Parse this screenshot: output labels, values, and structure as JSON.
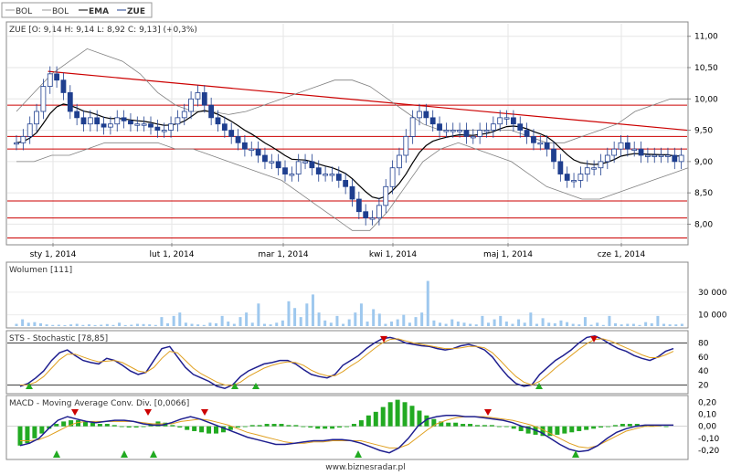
{
  "legend": {
    "items": [
      {
        "label": "BOL",
        "color": "#999999",
        "bold": false
      },
      {
        "label": "BOL",
        "color": "#999999",
        "bold": false
      },
      {
        "label": "EMA",
        "color": "#000000",
        "bold": true
      },
      {
        "label": "ZUE",
        "color": "#1f3f8f",
        "bold": true
      }
    ]
  },
  "footer": "www.biznesradar.pl",
  "colors": {
    "candle": "#1f3f8f",
    "trend": "#cc0000",
    "band": "#808080",
    "ema": "#000000",
    "volume": "#9ec8ee",
    "macd_pos": "#22aa22",
    "macd_neg": "#22aa22",
    "signal": "#e0a020"
  },
  "chart_data": [
    {
      "type": "candlestick",
      "title": "ZUE [O: 9,14  H: 9,14  L: 8,92  C: 9,13] (+0,3%)",
      "x_tick_labels": [
        "sty 1, 2014",
        "lut 1, 2014",
        "mar 1, 2014",
        "kwi 1, 2014",
        "maj 1, 2014",
        "cze 1, 2014"
      ],
      "y_tick_labels": [
        "8,00",
        "8,50",
        "9,00",
        "9,50",
        "10,00",
        "10,50",
        "11,00"
      ],
      "y_ticks": [
        8.0,
        8.5,
        9.0,
        9.5,
        10.0,
        10.5,
        11.0
      ],
      "ylim": [
        7.7,
        11.2
      ],
      "horizontal_levels": [
        9.9,
        9.4,
        9.2,
        8.37,
        8.1,
        7.78
      ],
      "trendline": {
        "from": [
          0.06,
          10.44
        ],
        "to": [
          1.0,
          9.5
        ]
      },
      "series_close": [
        9.3,
        9.4,
        9.6,
        9.8,
        10.2,
        10.4,
        10.3,
        10.1,
        9.8,
        9.7,
        9.6,
        9.7,
        9.6,
        9.55,
        9.6,
        9.7,
        9.65,
        9.6,
        9.6,
        9.6,
        9.55,
        9.5,
        9.5,
        9.6,
        9.7,
        9.8,
        10.0,
        10.1,
        9.9,
        9.7,
        9.6,
        9.5,
        9.4,
        9.3,
        9.2,
        9.2,
        9.1,
        9.0,
        9.0,
        8.9,
        8.8,
        8.8,
        9.0,
        9.0,
        8.9,
        8.8,
        8.8,
        8.8,
        8.7,
        8.6,
        8.4,
        8.2,
        8.1,
        8.1,
        8.3,
        8.6,
        8.9,
        9.1,
        9.4,
        9.7,
        9.8,
        9.7,
        9.6,
        9.5,
        9.5,
        9.5,
        9.5,
        9.4,
        9.4,
        9.5,
        9.5,
        9.6,
        9.7,
        9.7,
        9.6,
        9.5,
        9.4,
        9.3,
        9.3,
        9.2,
        9.0,
        8.8,
        8.7,
        8.7,
        8.8,
        8.9,
        8.9,
        9.0,
        9.1,
        9.2,
        9.3,
        9.2,
        9.2,
        9.1,
        9.1,
        9.1,
        9.1,
        9.1,
        9.0,
        9.1
      ],
      "bollinger_upper": [
        9.8,
        10.1,
        10.4,
        10.6,
        10.8,
        10.7,
        10.6,
        10.4,
        10.1,
        9.9,
        9.8,
        9.8,
        9.75,
        9.8,
        9.9,
        10.0,
        10.1,
        10.2,
        10.3,
        10.3,
        10.2,
        10.0,
        9.8,
        9.6,
        9.5,
        9.5,
        9.5,
        9.5,
        9.5,
        9.4,
        9.3,
        9.3,
        9.4,
        9.5,
        9.6,
        9.8,
        9.9,
        10.0,
        10.0
      ],
      "bollinger_lower": [
        9.0,
        9.0,
        9.1,
        9.1,
        9.2,
        9.3,
        9.3,
        9.3,
        9.3,
        9.2,
        9.2,
        9.1,
        9.0,
        8.9,
        8.8,
        8.7,
        8.5,
        8.3,
        8.1,
        7.9,
        7.9,
        8.2,
        8.6,
        9.0,
        9.2,
        9.3,
        9.2,
        9.1,
        9.0,
        8.8,
        8.6,
        8.5,
        8.4,
        8.4,
        8.5,
        8.6,
        8.7,
        8.8,
        8.9
      ]
    },
    {
      "type": "bar",
      "title": "Wolumen [111]",
      "y_tick_labels": [
        "10 000",
        "30 000"
      ],
      "y_ticks": [
        10000,
        30000
      ],
      "ylim": [
        0,
        55000
      ],
      "values": [
        2000,
        6000,
        3000,
        3500,
        2500,
        1500,
        1000,
        1200,
        800,
        1500,
        2000,
        1000,
        1500,
        900,
        1200,
        1800,
        1000,
        3000,
        900,
        1200,
        2000,
        1800,
        1500,
        1000,
        8000,
        2500,
        9000,
        12000,
        3000,
        2000,
        1500,
        1000,
        3000,
        2500,
        9000,
        4000,
        2000,
        8000,
        12000,
        3000,
        20000,
        2000,
        1500,
        3000,
        5000,
        22000,
        16000,
        8000,
        20000,
        28000,
        12000,
        5000,
        3000,
        9000,
        2000,
        6000,
        12000,
        20000,
        4000,
        15000,
        11000,
        2000,
        4000,
        6000,
        10000,
        3000,
        8000,
        12000,
        40000,
        5000,
        3000,
        2000,
        6000,
        4000,
        3000,
        2000,
        1500,
        9000,
        3000,
        6000,
        9000,
        4000,
        2000,
        6000,
        3000,
        12000,
        2000,
        7000,
        3000,
        2500,
        5000,
        3500,
        2000,
        1500,
        8000,
        1200,
        3000,
        1000,
        9000,
        2500,
        1500,
        2000,
        2000,
        1000,
        3500,
        2500,
        9000,
        2000,
        1500,
        1500,
        2000
      ]
    },
    {
      "type": "line",
      "title": "STS - Stochastic [78,85]",
      "y_tick_labels": [
        "20",
        "40",
        "60",
        "80"
      ],
      "y_ticks": [
        20,
        40,
        60,
        80
      ],
      "ylim": [
        10,
        95
      ],
      "levels": [
        20,
        80
      ],
      "series": [
        {
          "values": [
            18,
            22,
            30,
            40,
            55,
            66,
            70,
            62,
            55,
            52,
            50,
            58,
            55,
            48,
            40,
            35,
            38,
            55,
            72,
            75,
            60,
            45,
            35,
            30,
            25,
            18,
            15,
            20,
            32,
            40,
            45,
            50,
            52,
            55,
            55,
            50,
            42,
            35,
            32,
            30,
            35,
            48,
            55,
            62,
            72,
            80,
            86,
            88,
            85,
            80,
            78,
            76,
            75,
            72,
            70,
            72,
            76,
            78,
            75,
            70,
            60,
            45,
            32,
            22,
            18,
            20,
            35,
            45,
            55,
            62,
            70,
            80,
            88,
            90,
            85,
            78,
            72,
            68,
            62,
            58,
            55,
            60,
            68,
            72
          ]
        },
        {
          "values": [
            20,
            20,
            24,
            32,
            44,
            56,
            64,
            64,
            60,
            56,
            53,
            54,
            55,
            52,
            46,
            40,
            38,
            45,
            58,
            68,
            66,
            55,
            44,
            36,
            30,
            24,
            20,
            19,
            24,
            32,
            38,
            44,
            48,
            51,
            53,
            52,
            48,
            41,
            36,
            33,
            33,
            39,
            47,
            54,
            63,
            72,
            80,
            85,
            86,
            83,
            80,
            78,
            76,
            74,
            72,
            72,
            73,
            75,
            75,
            73,
            66,
            55,
            43,
            32,
            24,
            20,
            25,
            34,
            44,
            53,
            62,
            71,
            79,
            85,
            86,
            83,
            78,
            73,
            68,
            63,
            59,
            59,
            63,
            68
          ]
        }
      ]
    },
    {
      "type": "bar",
      "title": "MACD - Moving Average Conv. Div. [0,0066]",
      "y_tick_labels": [
        "-0,20",
        "-0,10",
        "0,00",
        "0,10",
        "0,20"
      ],
      "y_ticks": [
        -0.2,
        -0.1,
        0.0,
        0.1,
        0.2
      ],
      "ylim": [
        -0.26,
        0.24
      ],
      "histogram": [
        -0.16,
        -0.14,
        -0.1,
        -0.06,
        -0.02,
        0.02,
        0.04,
        0.05,
        0.05,
        0.04,
        0.03,
        0.02,
        0.02,
        0.01,
        0.0,
        -0.01,
        -0.01,
        0.0,
        0.02,
        0.04,
        0.03,
        0.01,
        -0.01,
        -0.03,
        -0.04,
        -0.05,
        -0.06,
        -0.06,
        -0.05,
        -0.03,
        -0.01,
        0.0,
        0.01,
        0.01,
        0.02,
        0.02,
        0.02,
        0.01,
        0.01,
        0.0,
        -0.01,
        -0.02,
        -0.02,
        -0.02,
        -0.01,
        0.0,
        0.02,
        0.05,
        0.09,
        0.12,
        0.16,
        0.2,
        0.22,
        0.2,
        0.17,
        0.13,
        0.09,
        0.06,
        0.04,
        0.03,
        0.03,
        0.02,
        0.02,
        0.01,
        0.01,
        0.01,
        0.0,
        0.0,
        -0.02,
        -0.04,
        -0.06,
        -0.07,
        -0.08,
        -0.08,
        -0.07,
        -0.06,
        -0.05,
        -0.04,
        -0.03,
        -0.02,
        -0.01,
        0.0,
        0.01,
        0.02,
        0.02,
        0.02,
        0.01,
        0.01,
        0.01,
        0.0
      ],
      "macd_line": [
        -0.16,
        -0.14,
        -0.1,
        -0.02,
        0.05,
        0.08,
        0.06,
        0.04,
        0.03,
        0.04,
        0.05,
        0.05,
        0.04,
        0.02,
        0.01,
        0.01,
        0.03,
        0.06,
        0.08,
        0.06,
        0.03,
        0.0,
        -0.03,
        -0.06,
        -0.09,
        -0.11,
        -0.13,
        -0.15,
        -0.15,
        -0.14,
        -0.13,
        -0.12,
        -0.12,
        -0.11,
        -0.11,
        -0.12,
        -0.14,
        -0.17,
        -0.2,
        -0.22,
        -0.18,
        -0.1,
        0.0,
        0.06,
        0.08,
        0.09,
        0.09,
        0.08,
        0.08,
        0.07,
        0.06,
        0.05,
        0.03,
        0.0,
        -0.02,
        -0.05,
        -0.1,
        -0.15,
        -0.19,
        -0.21,
        -0.2,
        -0.16,
        -0.1,
        -0.05,
        -0.02,
        0.0,
        0.01,
        0.01,
        0.01,
        0.01
      ],
      "signal_line": [
        -0.12,
        -0.12,
        -0.11,
        -0.08,
        -0.04,
        0.0,
        0.03,
        0.04,
        0.04,
        0.04,
        0.04,
        0.04,
        0.04,
        0.03,
        0.02,
        0.02,
        0.02,
        0.04,
        0.05,
        0.06,
        0.05,
        0.03,
        0.01,
        -0.02,
        -0.05,
        -0.07,
        -0.09,
        -0.11,
        -0.13,
        -0.14,
        -0.14,
        -0.13,
        -0.13,
        -0.12,
        -0.12,
        -0.12,
        -0.12,
        -0.14,
        -0.16,
        -0.18,
        -0.18,
        -0.15,
        -0.09,
        -0.03,
        0.02,
        0.05,
        0.07,
        0.08,
        0.08,
        0.08,
        0.07,
        0.06,
        0.05,
        0.03,
        0.01,
        -0.02,
        -0.06,
        -0.1,
        -0.14,
        -0.17,
        -0.18,
        -0.16,
        -0.12,
        -0.08,
        -0.04,
        -0.02,
        0.0,
        0.0,
        0.01,
        0.01
      ]
    }
  ]
}
